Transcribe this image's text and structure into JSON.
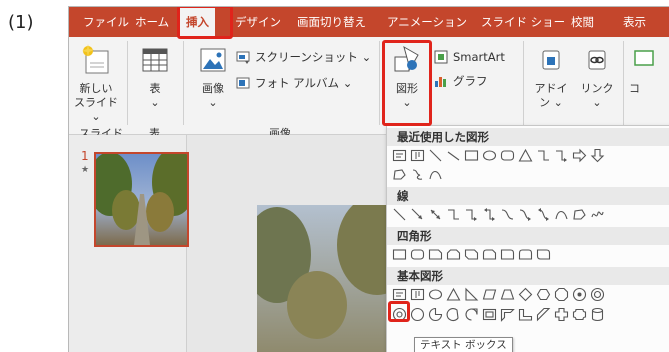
{
  "step_label": "(1)",
  "ribbon_tabs": [
    "ファイル",
    "ホーム",
    "挿入",
    "デザイン",
    "画面切り替え",
    "アニメーション",
    "スライド ショー",
    "校閲",
    "表示"
  ],
  "active_tab": "挿入",
  "ribbon": {
    "new_slide": {
      "line1": "新しい",
      "line2": "スライド ⌄"
    },
    "table_btn": {
      "label": "表",
      "caret": "⌄"
    },
    "image_btn": {
      "label": "画像",
      "caret": "⌄"
    },
    "screenshot_btn": "スクリーンショット ⌄",
    "photo_album_btn": "フォト アルバム ⌄",
    "shapes_btn": {
      "label": "図形",
      "caret": "⌄"
    },
    "smartart_btn": "SmartArt",
    "chart_btn": "グラフ",
    "addin_btn": {
      "line1": "アドイ",
      "line2": "ン ⌄"
    },
    "link_btn": {
      "label": "リンク",
      "caret": "⌄"
    },
    "comment_btn": "コ",
    "groups": {
      "slides": "スライド",
      "tables": "表",
      "images": "画像"
    }
  },
  "slide_pane": {
    "slide_number": "1",
    "star": "★"
  },
  "shapes_menu": {
    "recent": {
      "title": "最近使用した図形",
      "row1": [
        "text-box",
        "vertical-text-box",
        "line",
        "line-diagonal",
        "rectangle",
        "oval",
        "rounded-rectangle",
        "triangle",
        "elbow-connector",
        "elbow-arrow-connector",
        "right-arrow",
        "down-arrow"
      ],
      "row2": [
        "freeform",
        "curly",
        "curve"
      ]
    },
    "lines": {
      "title": "線",
      "row1": [
        "line",
        "arrow-line",
        "double-arrow-line",
        "elbow-connector",
        "elbow-arrow-connector",
        "elbow-double-arrow",
        "curved-connector",
        "curved-arrow-connector",
        "curved-double-arrow",
        "curve",
        "freeform",
        "scribble"
      ]
    },
    "rectangles": {
      "title": "四角形",
      "row1": [
        "rectangle",
        "rounded-rectangle",
        "snip-single-corner",
        "snip-same-side",
        "snip-diagonal",
        "snip-round",
        "round-single-corner",
        "round-same-side",
        "round-diagonal"
      ]
    },
    "basic": {
      "title": "基本図形",
      "row1": [
        "text-box",
        "vertical-text-box",
        "oval",
        "triangle",
        "right-triangle",
        "parallelogram",
        "trapezoid",
        "diamond",
        "hexagon",
        "octagon",
        "circle-7",
        "circle-8"
      ],
      "row2": [
        "circle-10",
        "circle-12",
        "pie",
        "chord",
        "teardrop",
        "frame",
        "half-frame",
        "l-shape",
        "diagonal-stripe",
        "cross",
        "plaque",
        "can"
      ]
    },
    "tooltip": "テキスト ボックス"
  },
  "colors": {
    "accent": "#c4462c",
    "highlight": "#e0241b"
  }
}
